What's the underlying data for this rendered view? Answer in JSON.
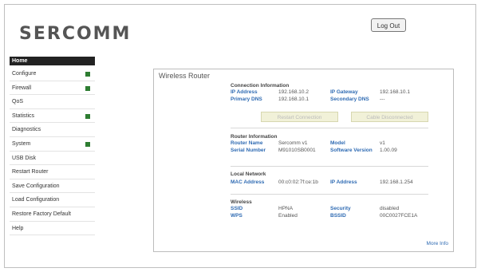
{
  "brand": {
    "logo_text": "SERCOMM"
  },
  "header": {
    "logout_label": "Log Out"
  },
  "sidebar": {
    "items": [
      {
        "label": "Home",
        "active": true,
        "expandable": false
      },
      {
        "label": "Configure",
        "expandable": true
      },
      {
        "label": "Firewall",
        "expandable": true
      },
      {
        "label": "QoS",
        "expandable": false
      },
      {
        "label": "Statistics",
        "expandable": true
      },
      {
        "label": "Diagnostics",
        "expandable": false
      },
      {
        "label": "System",
        "expandable": true
      },
      {
        "label": "USB Disk",
        "expandable": false
      },
      {
        "label": "Restart Router",
        "expandable": false
      },
      {
        "label": "Save Configuration",
        "expandable": false
      },
      {
        "label": "Load Configuration",
        "expandable": false
      },
      {
        "label": "Restore Factory Default",
        "expandable": false
      },
      {
        "label": "Help",
        "expandable": false
      }
    ]
  },
  "panel": {
    "title": "Wireless Router",
    "connection": {
      "title": "Connection Information",
      "ip_label": "IP Address",
      "ip_value": "192.168.10.2",
      "gw_label": "IP Gateway",
      "gw_value": "192.168.10.1",
      "pdns_label": "Primary DNS",
      "pdns_value": "192.168.10.1",
      "sdns_label": "Secondary DNS",
      "sdns_value": "---",
      "restart_button": "Restart Connection",
      "cable_button": "Cable Disconnected"
    },
    "router": {
      "title": "Router Information",
      "name_label": "Router Name",
      "name_value": "Sercomm v1",
      "model_label": "Model",
      "model_value": "v1",
      "serial_label": "Serial Number",
      "serial_value": "M91010SB0001",
      "sw_label": "Software Version",
      "sw_value": "1.00.09"
    },
    "local": {
      "title": "Local Network",
      "mac_label": "MAC Address",
      "mac_value": "00:c0:02:7f:ce:1b",
      "ip_label": "IP Address",
      "ip_value": "192.168.1.254"
    },
    "wireless": {
      "title": "Wireless",
      "ssid_label": "SSID",
      "ssid_value": "HPNA",
      "sec_label": "Security",
      "sec_value": "disabled",
      "wps_label": "WPS",
      "wps_value": "Enabled",
      "bssid_label": "BSSID",
      "bssid_value": "00C0027FCE1A"
    },
    "more_info": "More Info"
  }
}
